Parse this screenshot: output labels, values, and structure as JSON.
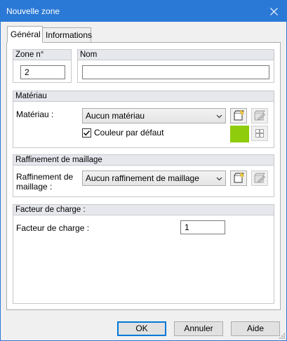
{
  "window": {
    "title": "Nouvelle zone"
  },
  "tabs": [
    {
      "label": "Général"
    },
    {
      "label": "Informations"
    }
  ],
  "zone_no": {
    "header": "Zone n°",
    "value": "2"
  },
  "nom": {
    "header": "Nom",
    "value": ""
  },
  "materiau": {
    "header": "Matériau",
    "label": "Matériau :",
    "selected": "Aucun matériau",
    "default_color_label": "Couleur par défaut",
    "default_color_checked": true,
    "swatch_color": "#8fcc0b"
  },
  "raffinement": {
    "header": "Raffinement de maillage",
    "label": "Raffinement de maillage :",
    "selected": "Aucun raffinement de maillage"
  },
  "facteur": {
    "header": "Facteur de charge :",
    "label": "Facteur de charge :",
    "value": "1"
  },
  "buttons": {
    "ok": "OK",
    "cancel": "Annuler",
    "help": "Aide"
  },
  "colors": {
    "titlebar": "#2b79d6",
    "accent": "#0078d7"
  }
}
